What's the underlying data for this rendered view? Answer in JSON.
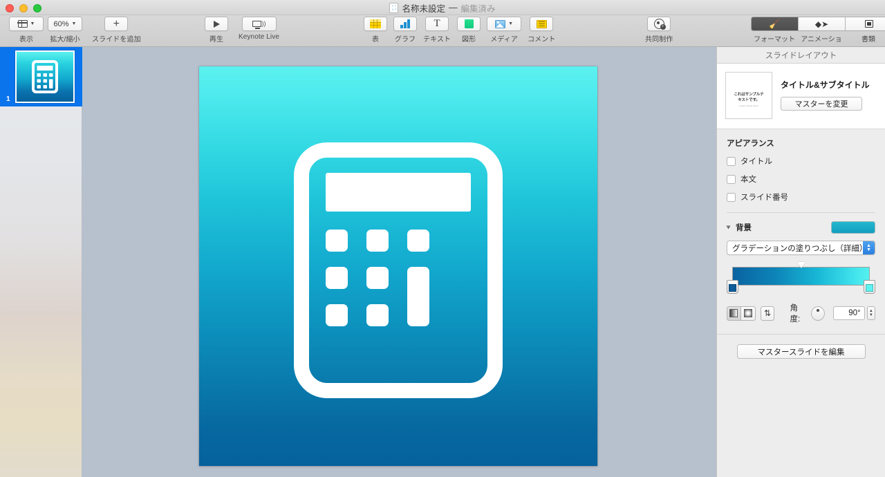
{
  "window": {
    "title": "名称未設定",
    "separator": "—",
    "edited": "編集済み",
    "doc_icon": "keynote-document-icon"
  },
  "toolbar": {
    "left": [
      {
        "label": "表示",
        "icon": "view-layout-icon",
        "has_caret": true
      },
      {
        "label": "拡大/縮小",
        "value": "60%",
        "icon": "zoom-percent",
        "has_caret": true
      },
      {
        "label": "スライドを追加",
        "icon": "plus-icon",
        "has_caret": false
      }
    ],
    "play": [
      {
        "label": "再生",
        "icon": "play-icon"
      },
      {
        "label": "Keynote Live",
        "icon": "keynote-live-icon"
      }
    ],
    "insert": [
      {
        "label": "表",
        "icon": "table-icon"
      },
      {
        "label": "グラフ",
        "icon": "chart-icon"
      },
      {
        "label": "テキスト",
        "icon": "text-icon"
      },
      {
        "label": "図形",
        "icon": "shape-icon"
      },
      {
        "label": "メディア",
        "icon": "media-icon",
        "has_caret": true
      },
      {
        "label": "コメント",
        "icon": "comment-icon"
      }
    ],
    "collaborate": {
      "label": "共同制作",
      "icon": "collaborate-icon"
    },
    "panels": [
      {
        "label": "フォーマット",
        "icon": "format-brush-icon",
        "active": true
      },
      {
        "label": "アニメーション",
        "icon": "animation-diamond-icon",
        "active": false
      },
      {
        "label": "書類",
        "icon": "document-icon",
        "active": false
      }
    ]
  },
  "sidebar": {
    "slides": [
      {
        "number": "1",
        "selected": true,
        "thumbnail": "calculator-slide-thumbnail"
      }
    ]
  },
  "canvas": {
    "slide_content": "calculator-icon-white-on-cyan-gradient",
    "background_top_color": "#5cf1ef",
    "background_bottom_color": "#05619c"
  },
  "inspector": {
    "title": "スライドレイアウト",
    "master": {
      "thumb_line1": "これはサンプルテ",
      "thumb_line2": "キストです。",
      "thumb_line3": "Lorem ipsum dolor",
      "name": "タイトル&サブタイトル",
      "change_button": "マスターを変更"
    },
    "appearance": {
      "heading": "アピアランス",
      "options": [
        {
          "label": "タイトル",
          "checked": false
        },
        {
          "label": "本文",
          "checked": false
        },
        {
          "label": "スライド番号",
          "checked": false
        }
      ]
    },
    "background": {
      "heading": "背景",
      "expanded": true,
      "swatch_color": "#17a7c4",
      "fill_type": "グラデーションの塗りつぶし（詳細）",
      "gradient_start_color": "#0a63a0",
      "gradient_end_color": "#55f0f0",
      "gradient_type_linear": "linear-gradient-button",
      "gradient_type_radial": "radial-gradient-button",
      "gradient_flip": "flip-gradient-button",
      "angle_label": "角度:",
      "angle_value": "90°"
    },
    "edit_master_button": "マスタースライドを編集"
  }
}
